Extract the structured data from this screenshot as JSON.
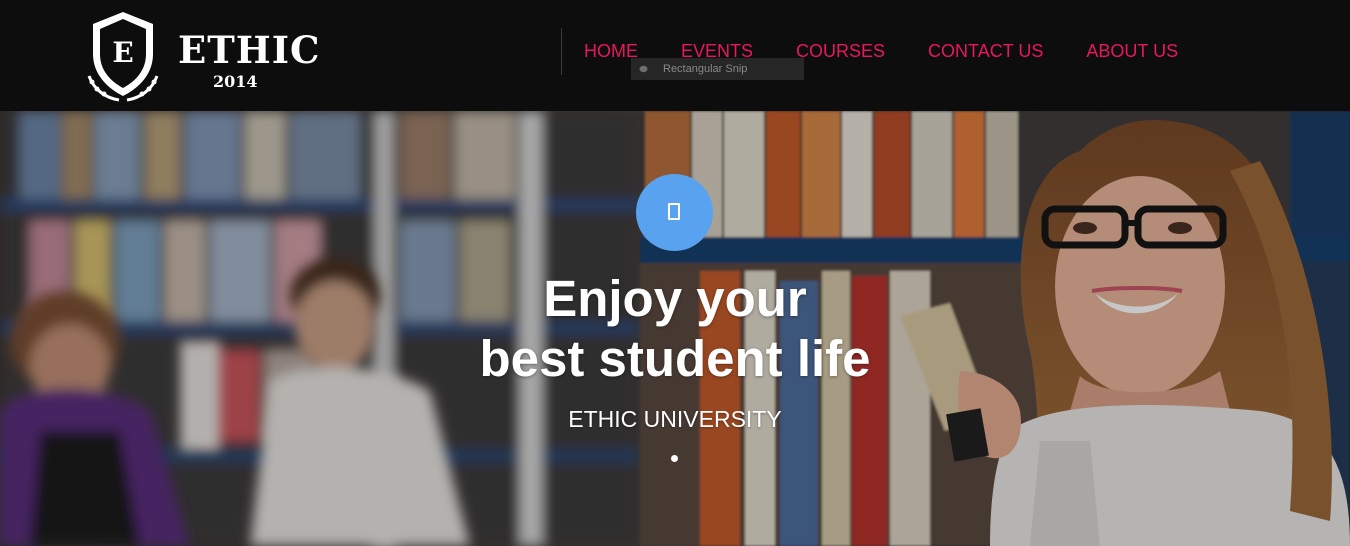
{
  "brand": {
    "name": "ETHIC",
    "year": "2014",
    "crest_letter": "E"
  },
  "nav": {
    "items": [
      {
        "label": "HOME"
      },
      {
        "label": "EVENTS"
      },
      {
        "label": "COURSES"
      },
      {
        "label": "CONTACT US"
      },
      {
        "label": "ABOUT US"
      }
    ]
  },
  "overlay": {
    "tooltip_text": "Rectangular Snip"
  },
  "hero": {
    "icon": "play-icon",
    "headline_line1": "Enjoy your",
    "headline_line2": "best student life",
    "subhead": "ETHIC UNIVERSITY"
  },
  "colors": {
    "nav_link": "#e8185d",
    "header_bg": "#0d0d0d",
    "icon_circle": "#58a2ef",
    "text": "#ffffff"
  }
}
